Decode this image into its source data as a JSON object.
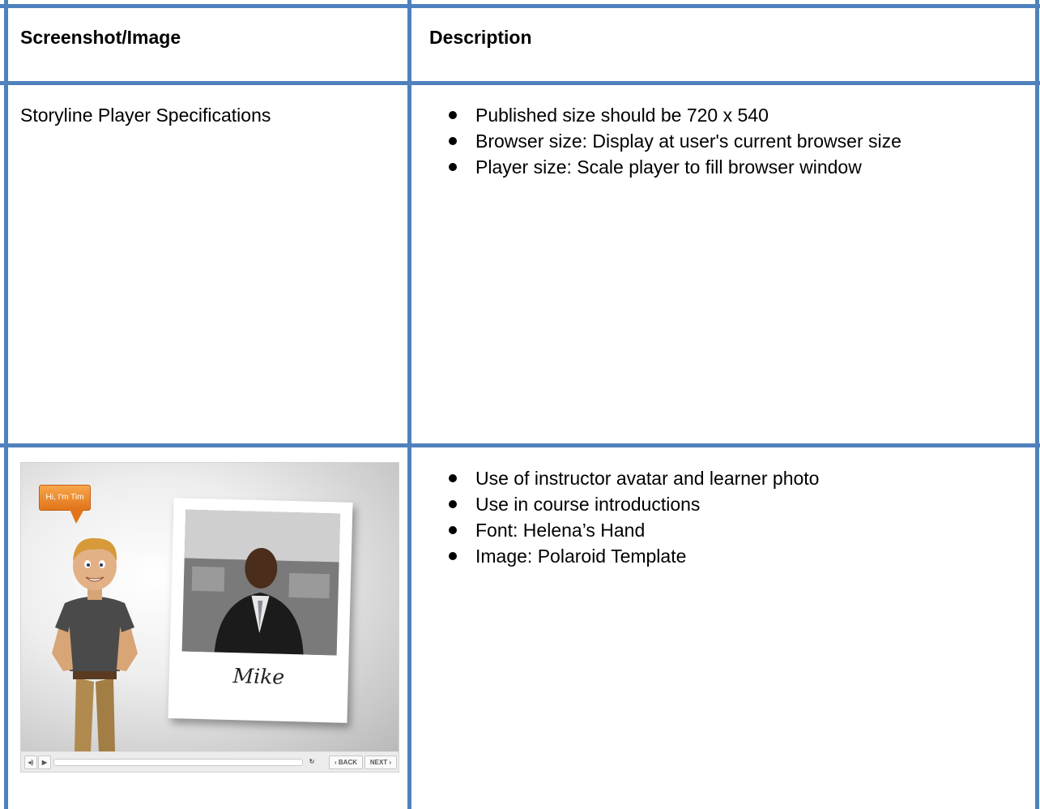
{
  "table": {
    "headers": {
      "col1": "Screenshot/Image",
      "col2": "Description"
    },
    "rows": [
      {
        "col1": "Storyline Player Specifications",
        "bullets": [
          "Published size should be 720 x 540",
          "Browser size: Display at user's current browser size",
          "Player size: Scale player to fill browser window"
        ]
      },
      {
        "col1_image": "storyline-player-screenshot",
        "bullets": [
          "Use of instructor avatar and learner photo",
          "Use in course introductions",
          "Font: Helena’s Hand",
          "Image: Polaroid Template"
        ]
      }
    ]
  },
  "player": {
    "bubble_text": "Hi, I'm Tim",
    "polaroid_caption": "Mike",
    "back_label": "‹ BACK",
    "next_label": "NEXT ›",
    "icons": [
      "volume-icon",
      "play-icon",
      "replay-icon"
    ]
  },
  "colors": {
    "table_border": "#4f81bd",
    "bubble_orange": "#e1741a"
  }
}
